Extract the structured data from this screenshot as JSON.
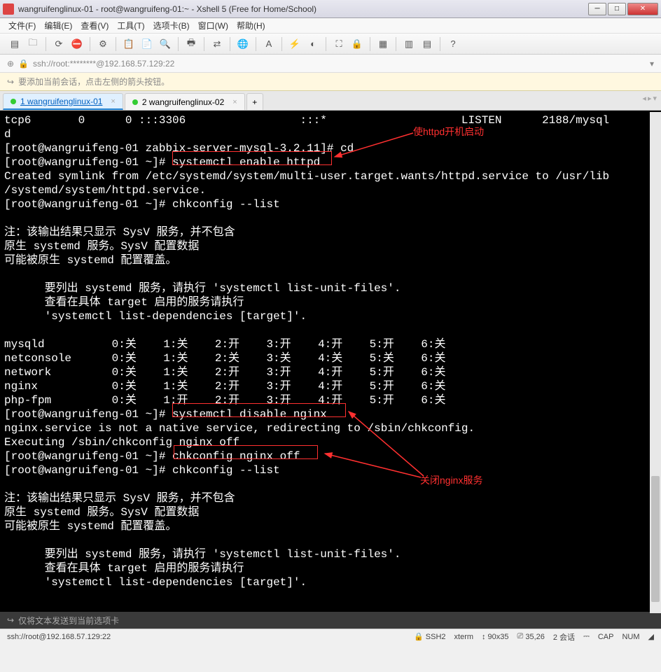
{
  "window": {
    "title": "wangruifenglinux-01 - root@wangruifeng-01:~ - Xshell 5 (Free for Home/School)"
  },
  "menu": {
    "file": "文件(F)",
    "edit": "编辑(E)",
    "view": "查看(V)",
    "tools": "工具(T)",
    "options": "选项卡(B)",
    "window": "窗口(W)",
    "help": "帮助(H)"
  },
  "address": {
    "path": "ssh://root:********@192.168.57.129:22"
  },
  "hint": {
    "text": "要添加当前会话，点击左侧的箭头按钮。"
  },
  "tabs": {
    "t1": "1 wangruifenglinux-01",
    "t2": "2 wangruifenglinux-02",
    "add": "+"
  },
  "terminal": {
    "lines": [
      "tcp6       0      0 :::3306                 :::*                    LISTEN      2188/mysql",
      "d           ",
      "[root@wangruifeng-01 zabbix-server-mysql-3.2.11]# cd",
      "[root@wangruifeng-01 ~]# systemctl enable httpd",
      "Created symlink from /etc/systemd/system/multi-user.target.wants/httpd.service to /usr/lib",
      "/systemd/system/httpd.service.",
      "[root@wangruifeng-01 ~]# chkconfig --list",
      "",
      "注：该输出结果只显示 SysV 服务，并不包含",
      "原生 systemd 服务。SysV 配置数据",
      "可能被原生 systemd 配置覆盖。",
      "",
      "      要列出 systemd 服务，请执行 'systemctl list-unit-files'.",
      "      查看在具体 target 启用的服务请执行",
      "      'systemctl list-dependencies [target]'.",
      "",
      "mysqld          0:关    1:关    2:开    3:开    4:开    5:开    6:关",
      "netconsole      0:关    1:关    2:关    3:关    4:关    5:关    6:关",
      "network         0:关    1:关    2:开    3:开    4:开    5:开    6:关",
      "nginx           0:关    1:关    2:开    3:开    4:开    5:开    6:关",
      "php-fpm         0:关    1:开    2:开    3:开    4:开    5:开    6:关",
      "[root@wangruifeng-01 ~]# systemctl disable nginx",
      "nginx.service is not a native service, redirecting to /sbin/chkconfig.",
      "Executing /sbin/chkconfig nginx off",
      "[root@wangruifeng-01 ~]# chkconfig nginx off",
      "[root@wangruifeng-01 ~]# chkconfig --list",
      "",
      "注：该输出结果只显示 SysV 服务，并不包含",
      "原生 systemd 服务。SysV 配置数据",
      "可能被原生 systemd 配置覆盖。",
      "",
      "      要列出 systemd 服务，请执行 'systemctl list-unit-files'.",
      "      查看在具体 target 启用的服务请执行",
      "      'systemctl list-dependencies [target]'.",
      ""
    ]
  },
  "annotations": {
    "a1": "使httpd开机启动",
    "a2": "关闭nginx服务"
  },
  "sendhint": {
    "text": "仅将文本发送到当前选项卡"
  },
  "status": {
    "left": "ssh://root@192.168.57.129:22",
    "ssh": "SSH2",
    "term": "xterm",
    "size": "90x35",
    "pos": "35,26",
    "sess": "2 会话",
    "cap": "CAP",
    "num": "NUM"
  }
}
